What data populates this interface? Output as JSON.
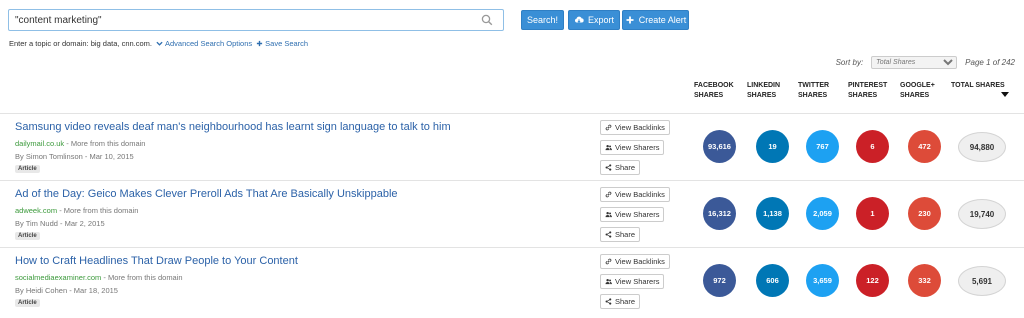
{
  "search": {
    "value": "\"content marketing\"",
    "placeholder": ""
  },
  "buttons": {
    "search": "Search!",
    "export": "Export",
    "create_alert": "Create Alert"
  },
  "hint": {
    "text": "Enter a topic or domain: big data, cnn.com.",
    "advanced": "Advanced Search Options",
    "save": "Save Search"
  },
  "sort": {
    "label": "Sort by:",
    "selected": "Total Shares",
    "page": "Page 1 of 242"
  },
  "columns": {
    "facebook": [
      "FACEBOOK",
      "SHARES"
    ],
    "linkedin": [
      "LINKEDIN",
      "SHARES"
    ],
    "twitter": [
      "TWITTER",
      "SHARES"
    ],
    "pinterest": [
      "PINTEREST",
      "SHARES"
    ],
    "googleplus": [
      "GOOGLE+",
      "SHARES"
    ],
    "total": "TOTAL SHARES"
  },
  "actions": {
    "backlinks": "View Backlinks",
    "sharers": "View Sharers",
    "share": "Share"
  },
  "colors": {
    "facebook": "#3b5998",
    "linkedin": "#0077b5",
    "twitter": "#1da1f2",
    "pinterest": "#cb2027",
    "googleplus": "#dd4b39",
    "accent": "#3a8fd6"
  },
  "results": [
    {
      "title": "Samsung video reveals deaf man's neighbourhood has learnt sign language to talk to him",
      "domain": "dailymail.co.uk",
      "more": " - More from this domain",
      "author": "By Simon Tomlinson - Mar 10, 2015",
      "badge": "Article",
      "facebook": "93,616",
      "linkedin": "19",
      "twitter": "767",
      "pinterest": "6",
      "googleplus": "472",
      "total": "94,880"
    },
    {
      "title": "Ad of the Day: Geico Makes Clever Preroll Ads That Are Basically Unskippable",
      "domain": "adweek.com",
      "more": " - More from this domain",
      "author": "By Tim Nudd - Mar 2, 2015",
      "badge": "Article",
      "facebook": "16,312",
      "linkedin": "1,138",
      "twitter": "2,059",
      "pinterest": "1",
      "googleplus": "230",
      "total": "19,740"
    },
    {
      "title": "How to Craft Headlines That Draw People to Your Content",
      "domain": "socialmediaexaminer.com",
      "more": " - More from this domain",
      "author": "By Heidi Cohen - Mar 18, 2015",
      "badge": "Article",
      "facebook": "972",
      "linkedin": "606",
      "twitter": "3,659",
      "pinterest": "122",
      "googleplus": "332",
      "total": "5,691"
    }
  ]
}
